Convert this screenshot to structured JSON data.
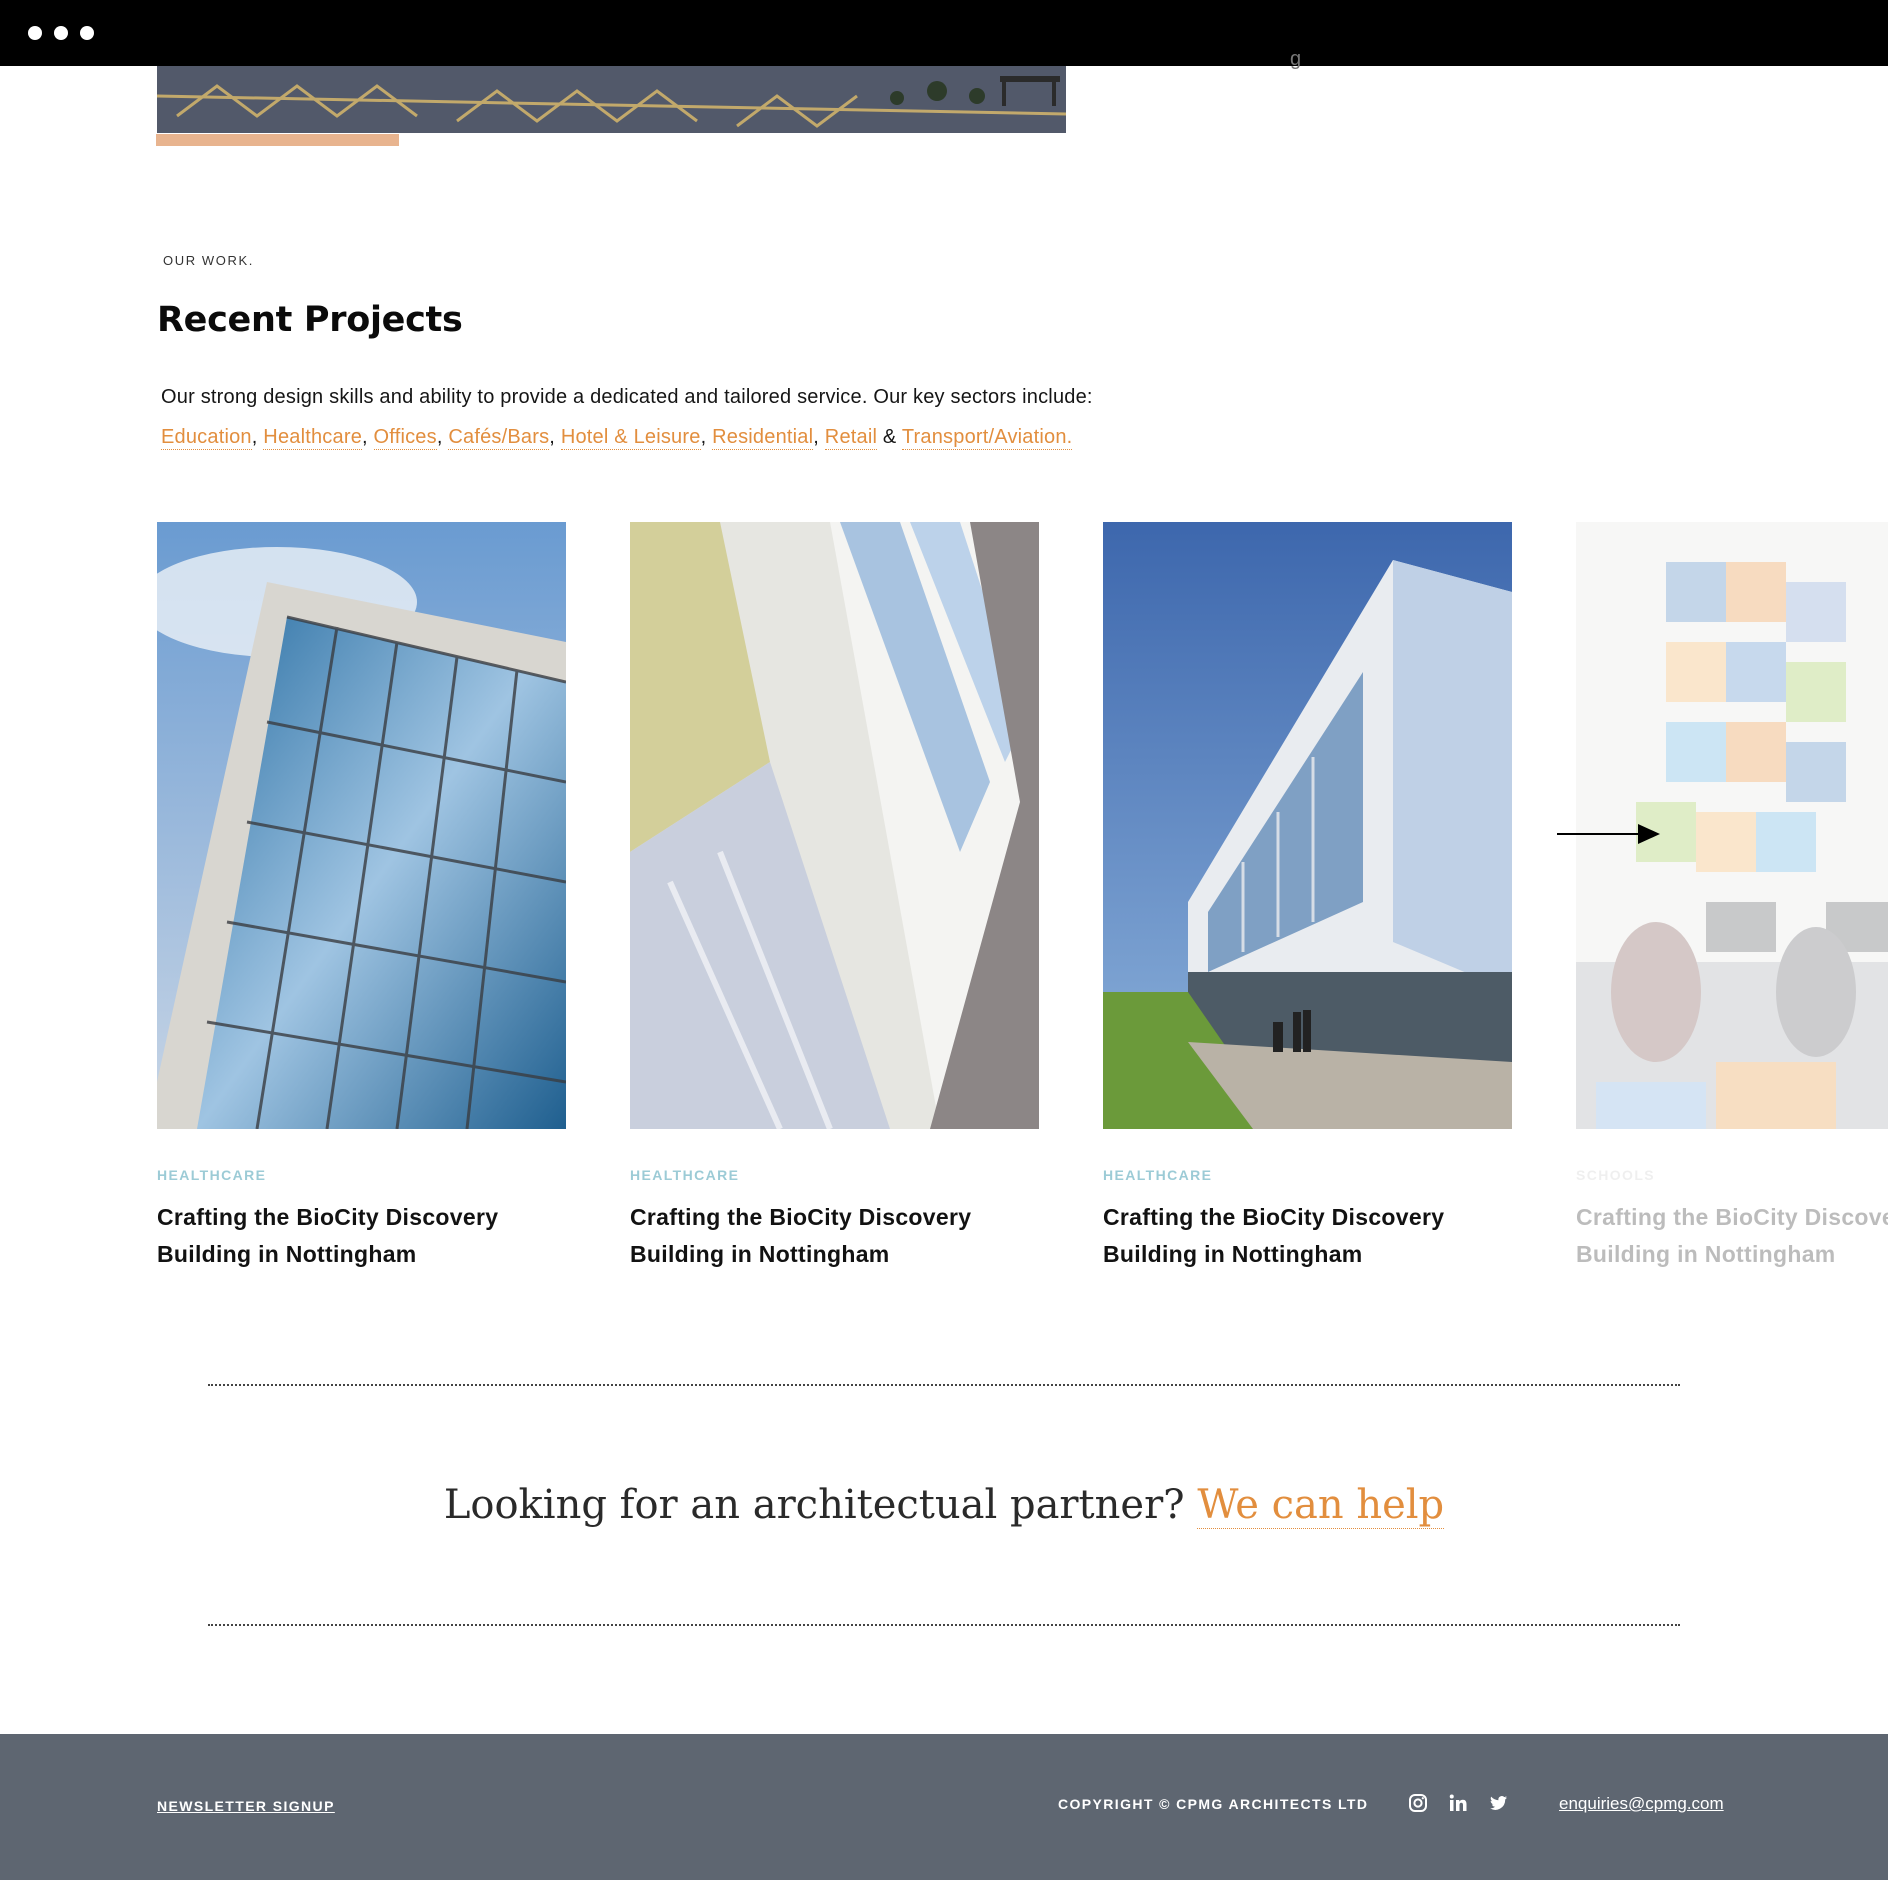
{
  "hero": {
    "fragment": "g"
  },
  "section": {
    "eyebrow": "OUR WORK.",
    "title": "Recent Projects",
    "intro": "Our strong design skills and ability to provide a dedicated and tailored service. Our key sectors include:",
    "sectors": [
      "Education",
      "Healthcare",
      "Offices",
      "Cafés/Bars",
      "Hotel & Leisure",
      "Residential",
      "Retail",
      "Transport/Aviation."
    ],
    "separator": ",",
    "ampersand": "&"
  },
  "projects": [
    {
      "category": "HEALTHCARE",
      "title": "Crafting the BioCity Discovery Building in Nottingham"
    },
    {
      "category": "HEALTHCARE",
      "title": "Crafting the BioCity Discovery Building in Nottingham"
    },
    {
      "category": "HEALTHCARE",
      "title": "Crafting the BioCity Discovery Building in Nottingham"
    },
    {
      "category": "SCHOOLS",
      "title": "Crafting the BioCity Discovery Building in Nottingham"
    }
  ],
  "carousel": {
    "next_icon": "arrow-right-icon"
  },
  "cta": {
    "question": "Looking for an architectual partner?",
    "link": "We can help"
  },
  "footer": {
    "newsletter": "NEWSLETTER SIGNUP",
    "copyright": "COPYRIGHT © CPMG ARCHITECTS LTD",
    "social_icons": [
      "instagram-icon",
      "linkedin-icon",
      "twitter-icon"
    ],
    "email": "enquiries@cpmg.com"
  },
  "colors": {
    "accent": "#e28e3e",
    "accent_bar": "#e8b48f",
    "category": "#9ccbd6",
    "footer_bg": "#5e6671"
  }
}
